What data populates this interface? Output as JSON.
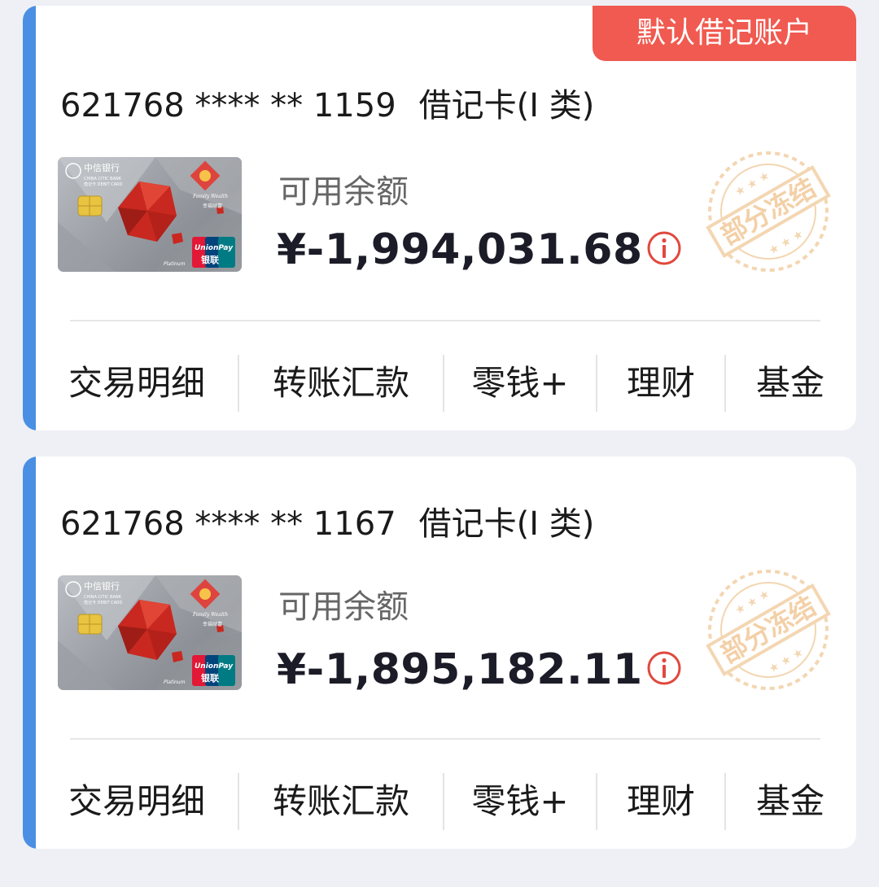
{
  "colors": {
    "accent": "#4a8fe3",
    "badge": "#f05a50",
    "stamp": "#f2cfa5",
    "info": "#e0493e"
  },
  "accounts": [
    {
      "badge": "默认借记账户",
      "masked_number": "621768 **** ** 1159",
      "account_type": "借记卡(I 类)",
      "balance_label": "可用余额",
      "balance": "¥-1,994,031.68",
      "stamp_text": "部分冻结",
      "card": {
        "bank_cn": "中信银行",
        "bank_en": "CHINA CITIC BANK",
        "card_kind": "借记卡 DEBIT CARD",
        "tier": "Platinum",
        "network": "UnionPay",
        "network_cn": "银联",
        "series": "幸福财富"
      },
      "actions": [
        "交易明细",
        "转账汇款",
        "零钱+",
        "理财",
        "基金"
      ]
    },
    {
      "masked_number": "621768 **** ** 1167",
      "account_type": "借记卡(I 类)",
      "balance_label": "可用余额",
      "balance": "¥-1,895,182.11",
      "stamp_text": "部分冻结",
      "card": {
        "bank_cn": "中信银行",
        "bank_en": "CHINA CITIC BANK",
        "card_kind": "借记卡 DEBIT CARD",
        "tier": "Platinum",
        "network": "UnionPay",
        "network_cn": "银联",
        "series": "幸福财富"
      },
      "actions": [
        "交易明细",
        "转账汇款",
        "零钱+",
        "理财",
        "基金"
      ]
    }
  ]
}
